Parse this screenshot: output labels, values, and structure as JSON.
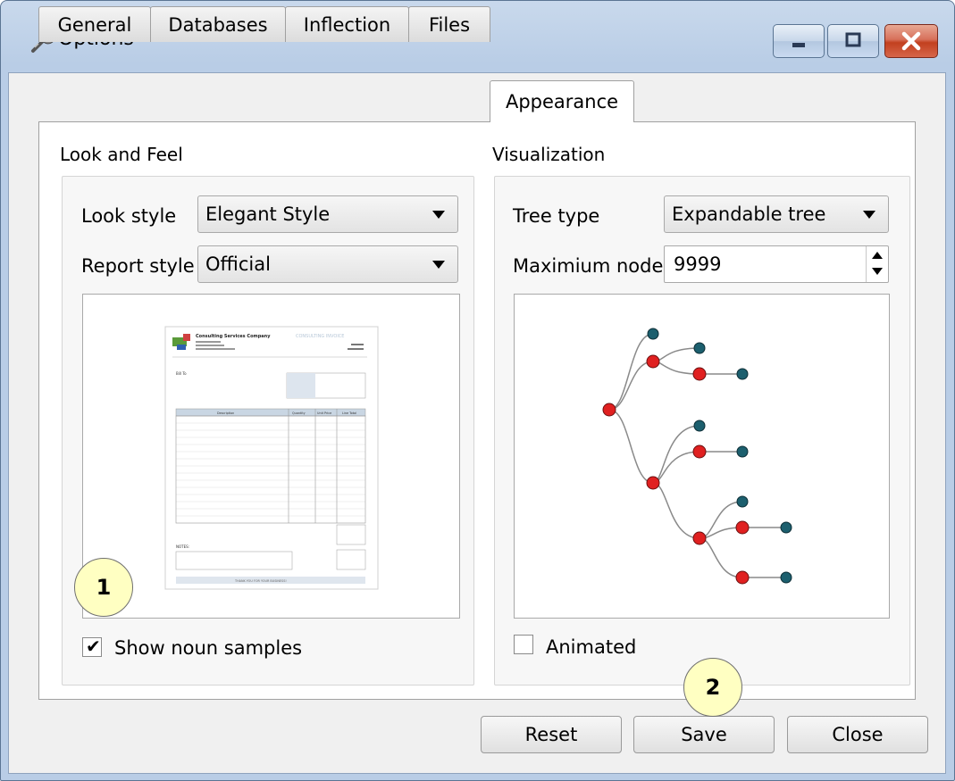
{
  "window": {
    "title": "Options"
  },
  "tabs": [
    {
      "label": "General"
    },
    {
      "label": "Databases"
    },
    {
      "label": "Inflection"
    },
    {
      "label": "Files"
    },
    {
      "label": "Appearance",
      "active": true
    }
  ],
  "look_and_feel": {
    "heading": "Look and Feel",
    "look_style_label": "Look style",
    "look_style_value": "Elegant Style",
    "report_style_label": "Report style",
    "report_style_value": "Official",
    "show_noun_samples_label": "Show noun samples",
    "show_noun_samples_checked": true,
    "report_preview": {
      "company": "Consulting Services Company",
      "doc_title": "CONSULTING INVOICE",
      "bill_to": "Bill To",
      "notes": "NOTES:",
      "footer": "THANK YOU FOR YOUR BUSINESS!",
      "columns": [
        "Description",
        "Quantity",
        "Unit Price",
        "Line Total"
      ]
    }
  },
  "visualization": {
    "heading": "Visualization",
    "tree_type_label": "Tree type",
    "tree_type_value": "Expandable tree",
    "max_nodes_label": "Maximium nodes",
    "max_nodes_value": "9999",
    "animated_label": "Animated",
    "animated_checked": false
  },
  "buttons": {
    "reset": "Reset",
    "save": "Save",
    "close": "Close"
  },
  "callouts": [
    "1",
    "2"
  ],
  "colors": {
    "node_red": "#e02020",
    "node_teal": "#1c5f6e",
    "edge": "#8a8a8a",
    "title_bar": "#b9cde6"
  }
}
